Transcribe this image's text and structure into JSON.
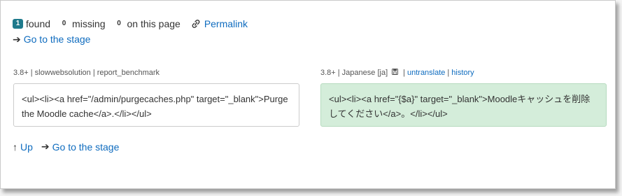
{
  "summary": {
    "found_count": "1",
    "found_label": "found",
    "missing_count": "0",
    "missing_label": "missing",
    "onpage_count": "0",
    "onpage_label": "on this page",
    "permalink_label": "Permalink",
    "goto_stage_label": "Go to the stage"
  },
  "source": {
    "meta": "3.8+ | slowwebsolution | report_benchmark",
    "text": "<ul><li><a href=\"/admin/purgecaches.php\" target=\"_blank\">Purge the Moodle cache</a>.</li></ul>"
  },
  "target": {
    "meta_prefix": "3.8+ | Japanese [ja]",
    "untranslate_label": "untranslate",
    "separator": "|",
    "history_label": "history",
    "text": "<ul><li><a href=\"{$a}\" target=\"_blank\">Moodleキャッシュを削除してください</a>。</li></ul>"
  },
  "footer": {
    "up_label": "Up",
    "goto_stage_label": "Go to the stage"
  },
  "icons": {
    "arrow_right": "right-arrow-icon",
    "arrow_up": "up-arrow-icon",
    "link": "link-icon",
    "save": "save-icon"
  },
  "colors": {
    "link": "#0f6cbf",
    "badge": "#1f7a8c",
    "target_bg": "#d4edda"
  }
}
